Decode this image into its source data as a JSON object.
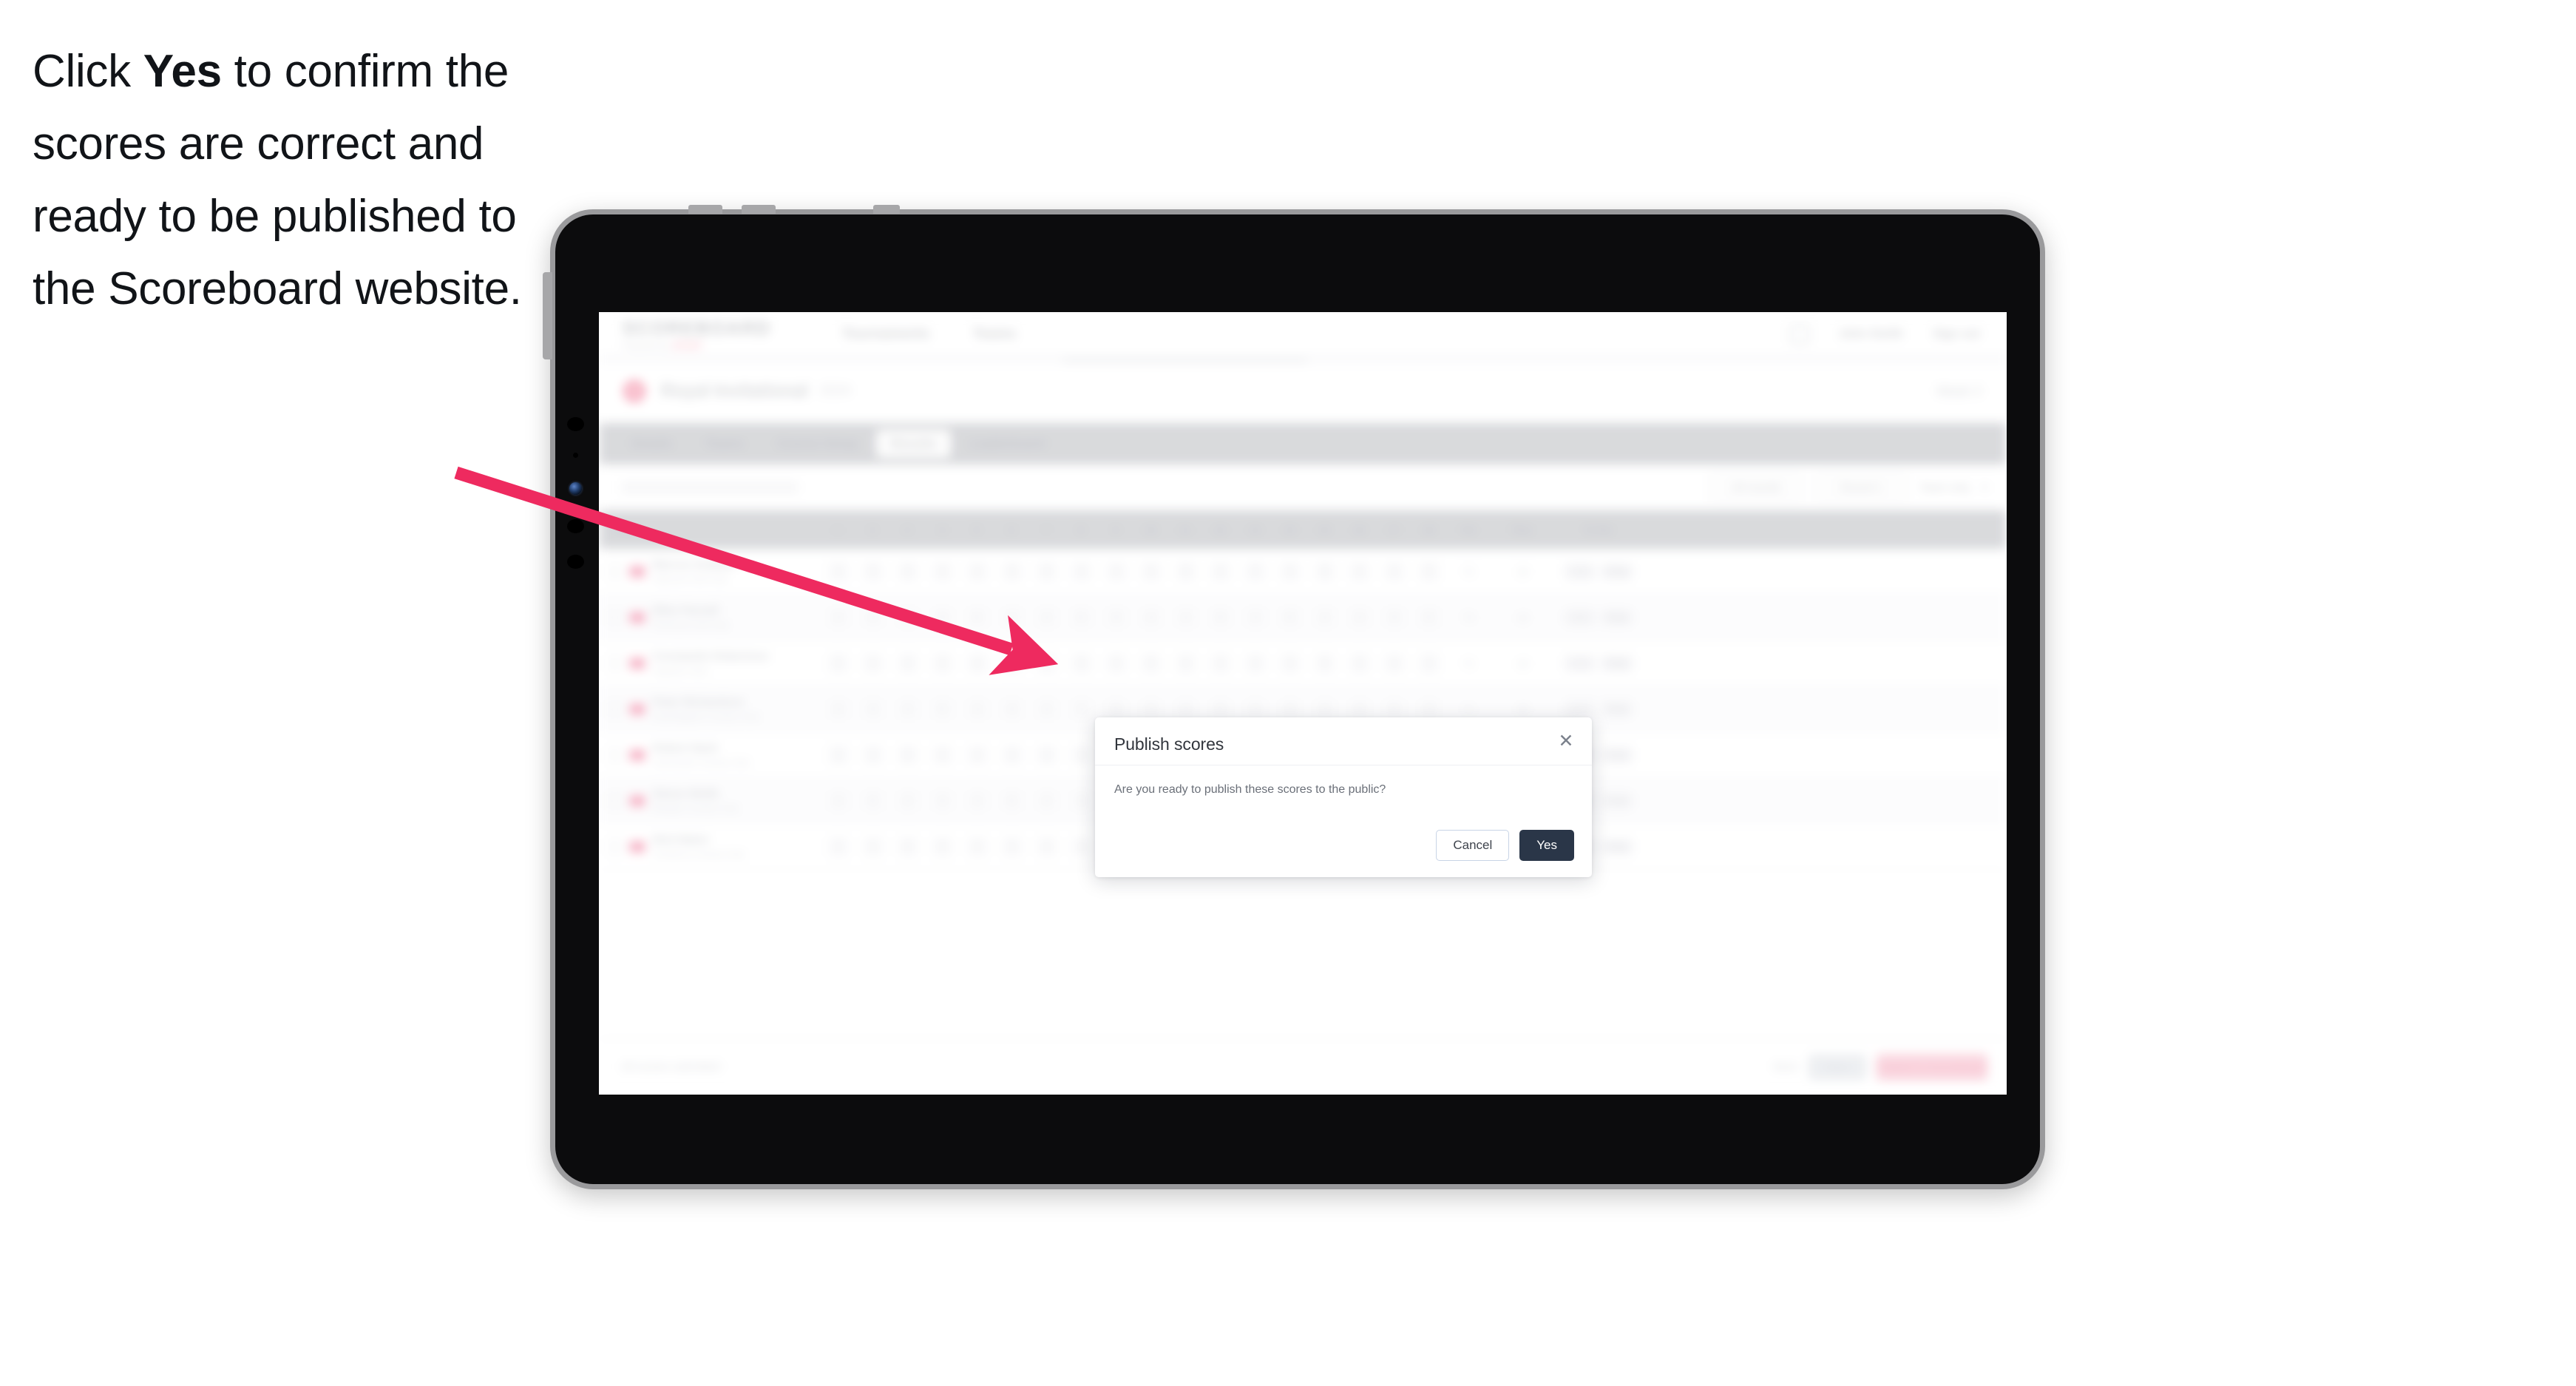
{
  "caption": {
    "prefix": "Click ",
    "bold": "Yes",
    "suffix": " to confirm the scores are correct and ready to be published to the Scoreboard website."
  },
  "colors": {
    "arrow": "#EE2A5F",
    "yes_button_bg": "#2A3648",
    "cancel_border": "#C8D4E6",
    "brand_accent": "#F4849F",
    "tab_bar_bg": "#D6D7DA"
  },
  "device": {
    "type": "tablet"
  },
  "app": {
    "brand": {
      "word": "SCOREBOARD",
      "sub_prefix": "Powered by ",
      "sub_accent": "SPORT"
    },
    "nav_links": [
      "Tournaments",
      "Teams"
    ],
    "nav_right": {
      "icon": "bell-icon",
      "user": "John Smith",
      "signout": "Sign out"
    },
    "event": {
      "flag_icon": "event-flag-icon",
      "title": "Royal Invitational",
      "sub": "2024",
      "right": "Week 3"
    },
    "tabs": [
      {
        "label": "Details",
        "active": false
      },
      {
        "label": "Teams",
        "active": false
      },
      {
        "label": "Course Setup",
        "active": false
      },
      {
        "label": "Results",
        "active": true
      },
      {
        "label": "Leaderboard",
        "active": false
      }
    ],
    "toolbar": {
      "filters": [
        "All rounds",
        "Round 1"
      ],
      "text": "Team only",
      "chevron": "chevron-down-icon"
    },
    "table": {
      "headers_player": "Player",
      "holes": [
        "1",
        "2",
        "3",
        "4",
        "5",
        "6",
        "7",
        "8",
        "9",
        "10",
        "11",
        "12",
        "13",
        "14",
        "15",
        "16",
        "17",
        "18"
      ],
      "headers_tail": [
        "Tot",
        "Thru",
        "To Par"
      ],
      "rows": [
        {
          "name": "Marcus Graham",
          "club": "Oakmont Golf Club",
          "holes": [
            "4",
            "5",
            "3",
            "4",
            "4",
            "3",
            "5",
            "4",
            "4",
            "4",
            "3",
            "4",
            "5",
            "4",
            "3",
            "4",
            "4",
            "5"
          ],
          "tot": "72",
          "thru": "18",
          "par": "+2",
          "score": "Final"
        },
        {
          "name": "Ellen Parnell",
          "club": "Pinehurst Golf Club",
          "holes": [
            "4",
            "4",
            "4",
            "3",
            "5",
            "4",
            "4",
            "5",
            "3",
            "4",
            "4",
            "3",
            "4",
            "5",
            "4",
            "4",
            "3",
            "5"
          ],
          "tot": "70",
          "thru": "18",
          "par": "E",
          "score": "Final"
        },
        {
          "name": "Constantin Robertson",
          "club": "Augusta Links",
          "holes": [
            "5",
            "4",
            "3",
            "4",
            "4",
            "4",
            "3",
            "5",
            "4",
            "5",
            "4",
            "4",
            "3",
            "4",
            "5",
            "3",
            "4",
            "4"
          ],
          "tot": "72",
          "thru": "18",
          "par": "+1",
          "score": "Final"
        },
        {
          "name": "Peter Richardson",
          "club": "Sandringham Country Club",
          "holes": [
            "4",
            "3",
            "4",
            "5",
            "4",
            "3",
            "4",
            "4",
            "5",
            "4",
            "3",
            "5",
            "4",
            "4",
            "4",
            "3",
            "5",
            "4"
          ],
          "tot": "71",
          "thru": "18",
          "par": "-1",
          "score": "Final"
        },
        {
          "name": "Robert Nash",
          "club": "Carnoustie Country Club",
          "holes": [
            "3",
            "4",
            "5",
            "4",
            "4",
            "4",
            "3",
            "4",
            "4",
            "5",
            "4",
            "4",
            "3",
            "5",
            "4",
            "4",
            "4",
            "3"
          ],
          "tot": "69",
          "thru": "18",
          "par": "-3",
          "score": "Final"
        },
        {
          "name": "Simon Wolfe",
          "club": "Birkdale Country Club",
          "holes": [
            "4",
            "5",
            "4",
            "3",
            "4",
            "5",
            "4",
            "3",
            "4",
            "4",
            "5",
            "4",
            "4",
            "3",
            "4",
            "5",
            "3",
            "4"
          ],
          "tot": "73",
          "thru": "18",
          "par": "+2",
          "score": "Final"
        },
        {
          "name": "Nick Baker",
          "club": "Turnberry Country Club",
          "holes": [
            "4",
            "4",
            "3",
            "5",
            "4",
            "4",
            "4",
            "4",
            "3",
            "5",
            "4",
            "3",
            "4",
            "4",
            "5",
            "4",
            "4",
            "4"
          ],
          "tot": "70",
          "thru": "18",
          "par": "E",
          "score": "Final"
        }
      ]
    },
    "footer": {
      "note": "All scores submitted",
      "ghost": "Back",
      "grey": "Save",
      "pink": "Publish to Scoreboard"
    }
  },
  "modal": {
    "title": "Publish scores",
    "close_icon": "close-icon",
    "message": "Are you ready to publish these scores to the public?",
    "cancel_label": "Cancel",
    "yes_label": "Yes"
  }
}
